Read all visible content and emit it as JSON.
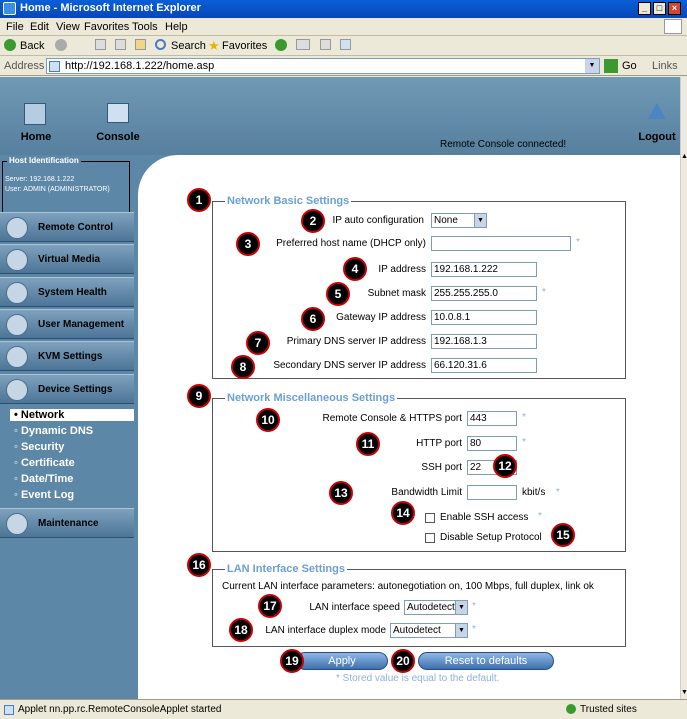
{
  "window": {
    "title": "Home - Microsoft Internet Explorer",
    "min": "_",
    "max": "□",
    "close": "×"
  },
  "menu": [
    "File",
    "Edit",
    "View",
    "Favorites",
    "Tools",
    "Help"
  ],
  "toolbar": {
    "back": "Back",
    "search": "Search",
    "favorites": "Favorites"
  },
  "address": {
    "label": "Address",
    "url": "http://192.168.1.222/home.asp",
    "go": "Go",
    "links": "Links"
  },
  "banner": {
    "home": "Home",
    "console": "Console",
    "status": "Remote Console connected!",
    "logout": "Logout"
  },
  "host": {
    "title": "Host Identification",
    "server": "Server: 192.168.1.222",
    "user": "User: ADMIN (ADMINISTRATOR)"
  },
  "sidebar": {
    "items": [
      "Remote Control",
      "Virtual Media",
      "System Health",
      "User Management",
      "KVM Settings",
      "Device Settings"
    ],
    "subitems": [
      "Network",
      "Dynamic DNS",
      "Security",
      "Certificate",
      "Date/Time",
      "Event Log"
    ],
    "maintenance": "Maintenance"
  },
  "basic": {
    "legend": "Network Basic Settings",
    "ip_auto_label": "IP auto configuration",
    "ip_auto_value": "None",
    "hostname_label": "Preferred host name (DHCP only)",
    "hostname_value": "",
    "ip_label": "IP address",
    "ip_value": "192.168.1.222",
    "mask_label": "Subnet mask",
    "mask_value": "255.255.255.0",
    "gw_label": "Gateway IP address",
    "gw_value": "10.0.8.1",
    "dns1_label": "Primary DNS server IP address",
    "dns1_value": "192.168.1.3",
    "dns2_label": "Secondary DNS server IP address",
    "dns2_value": "66.120.31.6"
  },
  "misc": {
    "legend": "Network Miscellaneous Settings",
    "rc_label": "Remote Console & HTTPS port",
    "rc_value": "443",
    "http_label": "HTTP port",
    "http_value": "80",
    "ssh_label": "SSH port",
    "ssh_value": "22",
    "bw_label": "Bandwidth Limit",
    "bw_value": "",
    "bw_unit": "kbit/s",
    "ssh_enable": "Enable SSH access",
    "setup_disable": "Disable Setup Protocol"
  },
  "lan": {
    "legend": "LAN Interface Settings",
    "params": "Current LAN interface parameters:  autonegotiation on, 100 Mbps, full duplex, link ok",
    "speed_label": "LAN interface speed",
    "speed_value": "Autodetect",
    "duplex_label": "LAN interface duplex mode",
    "duplex_value": "Autodetect"
  },
  "buttons": {
    "apply": "Apply",
    "reset": "Reset to defaults",
    "note": "* Stored value is equal to the default."
  },
  "star": "*",
  "badges": [
    "1",
    "2",
    "3",
    "4",
    "5",
    "6",
    "7",
    "8",
    "9",
    "10",
    "11",
    "12",
    "13",
    "14",
    "15",
    "16",
    "17",
    "18",
    "19",
    "20"
  ],
  "status": {
    "text": "Applet nn.pp.rc.RemoteConsoleApplet started",
    "zone": "Trusted sites"
  }
}
